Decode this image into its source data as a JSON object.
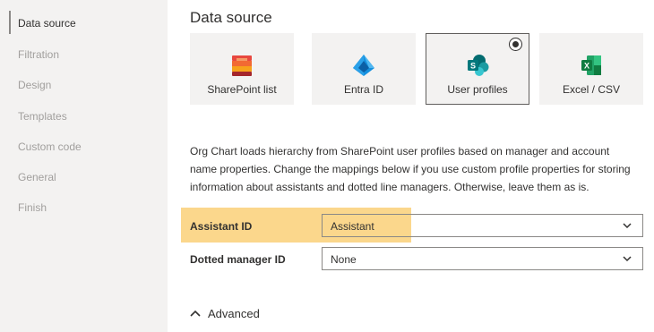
{
  "sidebar": {
    "items": [
      {
        "label": "Data source",
        "active": true
      },
      {
        "label": "Filtration",
        "active": false
      },
      {
        "label": "Design",
        "active": false
      },
      {
        "label": "Templates",
        "active": false
      },
      {
        "label": "Custom code",
        "active": false
      },
      {
        "label": "General",
        "active": false
      },
      {
        "label": "Finish",
        "active": false
      }
    ]
  },
  "main": {
    "title": "Data source",
    "sources": [
      {
        "label": "SharePoint list",
        "icon": "sharepoint-list-icon",
        "selected": false
      },
      {
        "label": "Entra ID",
        "icon": "entra-id-icon",
        "selected": false
      },
      {
        "label": "User profiles",
        "icon": "sharepoint-icon",
        "selected": true
      },
      {
        "label": "Excel / CSV",
        "icon": "excel-icon",
        "selected": false
      }
    ],
    "description": "Org Chart loads hierarchy from SharePoint user profiles based on manager and account name properties. Change the mappings below if you use custom profile properties for storing information about assistants and dotted line managers. Otherwise, leave them as is.",
    "fields": {
      "assistant": {
        "label": "Assistant ID",
        "value": "Assistant"
      },
      "dotted": {
        "label": "Dotted manager ID",
        "value": "None"
      }
    },
    "advanced_label": "Advanced"
  },
  "colors": {
    "sidebar_bg": "#f3f2f1",
    "highlight": "#fbd37f",
    "text": "#323130",
    "muted_text": "#a19f9d"
  }
}
